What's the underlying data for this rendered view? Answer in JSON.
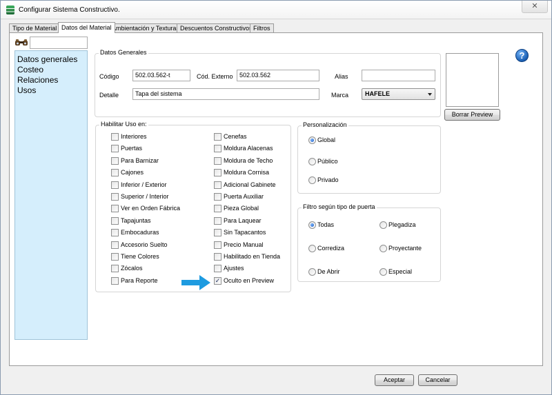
{
  "window": {
    "title": "Configurar Sistema Constructivo.",
    "close_glyph": "✕"
  },
  "tabs": [
    "Tipo de Material",
    "Datos del Material",
    "Ambientación y Texturas",
    "Descuentos Constructivos",
    "Filtros"
  ],
  "active_tab": "Datos del Material",
  "leftnav": {
    "search_value": "",
    "items": [
      "Datos generales",
      "Costeo",
      "Relaciones",
      "Usos"
    ]
  },
  "datos_generales": {
    "title": "Datos Generales",
    "codigo_label": "Código",
    "codigo_value": "502.03.562-t",
    "cod_externo_label": "Cód. Externo",
    "cod_externo_value": "502.03.562",
    "alias_label": "Alias",
    "alias_value": "",
    "detalle_label": "Detalle",
    "detalle_value": "Tapa del sistema",
    "marca_label": "Marca",
    "marca_value": "HAFELE"
  },
  "preview": {
    "borrar_label": "Borrar Preview"
  },
  "help_glyph": "?",
  "habilitar": {
    "title": "Habilitar Uso en:",
    "col1": [
      {
        "label": "Interiores",
        "checked": false
      },
      {
        "label": "Puertas",
        "checked": false
      },
      {
        "label": "Para Barnizar",
        "checked": false
      },
      {
        "label": "Cajones",
        "checked": false
      },
      {
        "label": "Inferior / Exterior",
        "checked": false
      },
      {
        "label": "Superior / Interior",
        "checked": false
      },
      {
        "label": "Ver en Orden Fábrica",
        "checked": false
      },
      {
        "label": "Tapajuntas",
        "checked": false
      },
      {
        "label": "Embocaduras",
        "checked": false
      },
      {
        "label": "Accesorio Suelto",
        "checked": false
      },
      {
        "label": "Tiene Colores",
        "checked": false
      },
      {
        "label": "Zócalos",
        "checked": false
      },
      {
        "label": "Para Reporte",
        "checked": false
      }
    ],
    "col2": [
      {
        "label": "Cenefas",
        "checked": false
      },
      {
        "label": "Moldura Alacenas",
        "checked": false
      },
      {
        "label": "Moldura de Techo",
        "checked": false
      },
      {
        "label": "Moldura Cornisa",
        "checked": false
      },
      {
        "label": "Adicional Gabinete",
        "checked": false
      },
      {
        "label": "Puerta Auxiliar",
        "checked": false
      },
      {
        "label": "Pieza Global",
        "checked": false
      },
      {
        "label": "Para Laquear",
        "checked": false
      },
      {
        "label": "Sin Tapacantos",
        "checked": false
      },
      {
        "label": "Precio Manual",
        "checked": false
      },
      {
        "label": "Habilitado en Tienda",
        "checked": false
      },
      {
        "label": "Ajustes",
        "checked": false
      },
      {
        "label": "Oculto en Preview",
        "checked": true
      }
    ]
  },
  "personalizacion": {
    "title": "Personalización",
    "options": [
      {
        "label": "Global",
        "checked": true
      },
      {
        "label": "Público",
        "checked": false
      },
      {
        "label": "Privado",
        "checked": false
      }
    ]
  },
  "filtro_puerta": {
    "title": "Filtro según tipo de puerta",
    "options": [
      {
        "label": "Todas",
        "checked": true
      },
      {
        "label": "Plegadiza",
        "checked": false
      },
      {
        "label": "Corrediza",
        "checked": false
      },
      {
        "label": "Proyectante",
        "checked": false
      },
      {
        "label": "De Abrir",
        "checked": false
      },
      {
        "label": "Especial",
        "checked": false
      }
    ]
  },
  "footer": {
    "aceptar_label": "Aceptar",
    "cancelar_label": "Cancelar"
  },
  "colors": {
    "annotation_arrow": "#1e9be0",
    "nav_background": "#d5eefc"
  }
}
